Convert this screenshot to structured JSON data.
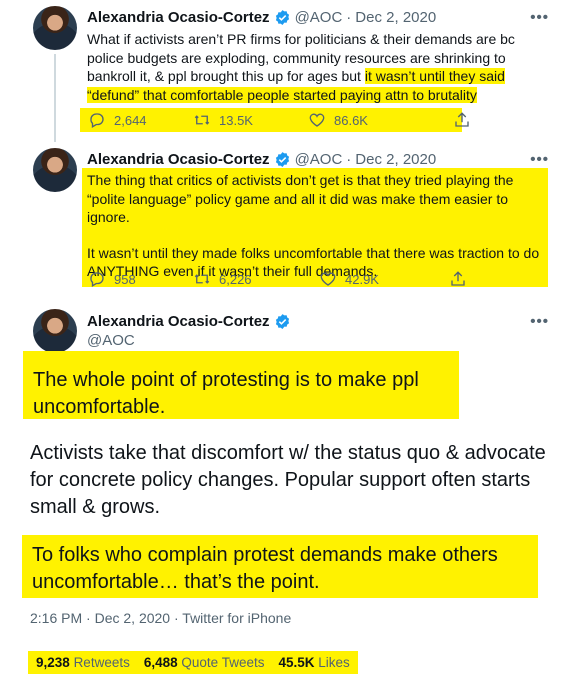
{
  "account": {
    "name": "Alexandria Ocasio-Cortez",
    "handle": "@AOC"
  },
  "tweets": [
    {
      "date": "Dec 2, 2020",
      "text_plain": "What if activists aren’t PR firms for politicians & their demands are bc police budgets are exploding, community resources are shrinking to bankroll it, & ppl brought this up for ages but",
      "text_highlight": "it wasn’t until they said “defund” that comfortable people started paying attn to brutality",
      "replies": "2,644",
      "retweets": "13.5K",
      "likes": "86.6K"
    },
    {
      "date": "Dec 2, 2020",
      "text_p1": "The thing that critics of activists don’t get is that they tried playing the “polite language” policy game and all it did was make them easier to ignore.",
      "text_p2": "It wasn’t until they made folks uncomfortable that there was traction to do ANYTHING even if it wasn’t their full demands.",
      "replies": "958",
      "retweets": "6,226",
      "likes": "42.9K"
    }
  ],
  "main_tweet": {
    "p1": "The whole point of protesting is to make ppl uncomfortable.",
    "p2": "Activists take that discomfort w/ the status quo & advocate for concrete policy changes. Popular support often starts small & grows.",
    "p3": "To folks who complain protest demands make others uncomfortable… that’s the point.",
    "time": "2:16 PM",
    "date": "Dec 2, 2020",
    "source": "Twitter for iPhone",
    "retweets_count": "9,238",
    "retweets_label": "Retweets",
    "quotes_count": "6,488",
    "quotes_label": "Quote Tweets",
    "likes_count": "45.5K",
    "likes_label": "Likes"
  },
  "ui": {
    "dot_separator": "·",
    "more_glyph": "•••"
  },
  "colors": {
    "highlight": "#fff200",
    "verified": "#1d9bf0",
    "muted": "#536471"
  }
}
